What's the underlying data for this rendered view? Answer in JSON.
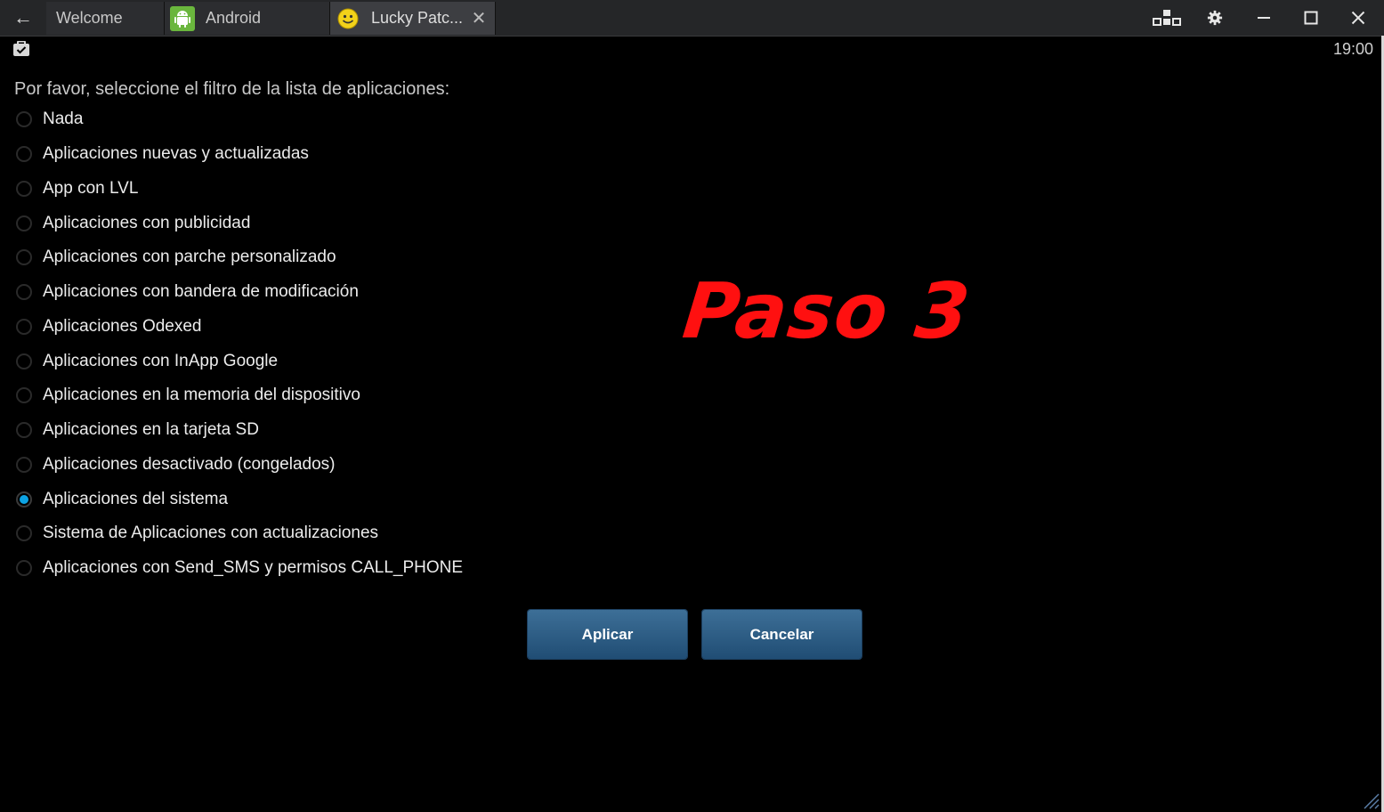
{
  "topbar": {
    "back_icon": "arrow-left-icon",
    "tabs": [
      {
        "label": "Welcome",
        "icon": ""
      },
      {
        "label": "Android",
        "icon": "android-icon"
      },
      {
        "label": "Lucky Patc...",
        "icon": "smiley-icon",
        "active": true
      }
    ],
    "window_controls": [
      "multi-instance-icon",
      "gear-icon",
      "minimize-icon",
      "maximize-icon",
      "close-icon"
    ]
  },
  "status": {
    "notification_icon": "clipboard-check-icon",
    "time": "19:00"
  },
  "dialog": {
    "prompt": "Por favor, seleccione el filtro de la lista de aplicaciones:",
    "options": [
      {
        "label": "Nada",
        "selected": false
      },
      {
        "label": "Aplicaciones nuevas y actualizadas",
        "selected": false
      },
      {
        "label": "App con LVL",
        "selected": false
      },
      {
        "label": "Aplicaciones con publicidad",
        "selected": false
      },
      {
        "label": "Aplicaciones con parche personalizado",
        "selected": false
      },
      {
        "label": "Aplicaciones con bandera de modificación",
        "selected": false
      },
      {
        "label": "Aplicaciones Odexed",
        "selected": false
      },
      {
        "label": "Aplicaciones con InApp Google",
        "selected": false
      },
      {
        "label": "Aplicaciones en la memoria del dispositivo",
        "selected": false
      },
      {
        "label": "Aplicaciones en la tarjeta SD",
        "selected": false
      },
      {
        "label": "Aplicaciones desactivado (congelados)",
        "selected": false
      },
      {
        "label": "Aplicaciones del sistema",
        "selected": true
      },
      {
        "label": "Sistema de Aplicaciones con actualizaciones",
        "selected": false
      },
      {
        "label": "Aplicaciones con Send_SMS y permisos CALL_PHONE",
        "selected": false
      }
    ],
    "apply_label": "Aplicar",
    "cancel_label": "Cancelar"
  },
  "overlay": {
    "text": "Paso 3",
    "color": "#ff1010"
  },
  "colors": {
    "accent": "#0ca3e4",
    "button": "#2f5f87"
  }
}
